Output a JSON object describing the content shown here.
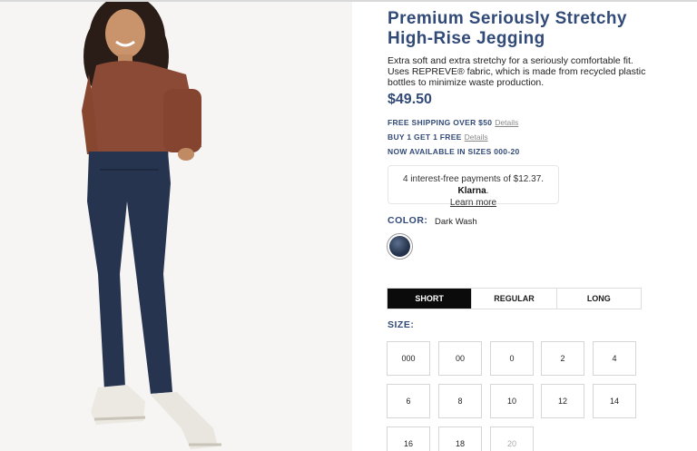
{
  "product": {
    "title_line1": "Premium Seriously Stretchy",
    "title_line2": "High-Rise Jegging",
    "description": "Extra soft and extra stretchy for a seriously comfortable fit. Uses REPREVE® fabric, which is made from recycled plastic bottles to minimize waste production.",
    "price": "$49.50"
  },
  "promos": [
    {
      "text": "FREE SHIPPING OVER $50",
      "link": "Details"
    },
    {
      "text": "BUY 1 GET 1 FREE",
      "link": "Details"
    },
    {
      "text": "NOW AVAILABLE IN SIZES 000-20",
      "link": ""
    }
  ],
  "klarna": {
    "text": "4 interest-free payments of $12.37.",
    "brand": "Klarna",
    "brand_suffix": ".",
    "link": "Learn more"
  },
  "color": {
    "label": "COLOR:",
    "value": "Dark Wash",
    "swatch_color": "#26344d"
  },
  "length_tabs": [
    {
      "label": "SHORT",
      "active": true
    },
    {
      "label": "REGULAR",
      "active": false
    },
    {
      "label": "LONG",
      "active": false
    }
  ],
  "size": {
    "label": "SIZE:",
    "options": [
      "000",
      "00",
      "0",
      "2",
      "4",
      "6",
      "8",
      "10",
      "12",
      "14",
      "16",
      "18",
      "20"
    ],
    "unavailable": [
      "20"
    ]
  },
  "colors": {
    "accent": "#324a78",
    "active_tab": "#0b0b0b",
    "sweater": "#8a4a36",
    "jeans": "#27344f"
  }
}
